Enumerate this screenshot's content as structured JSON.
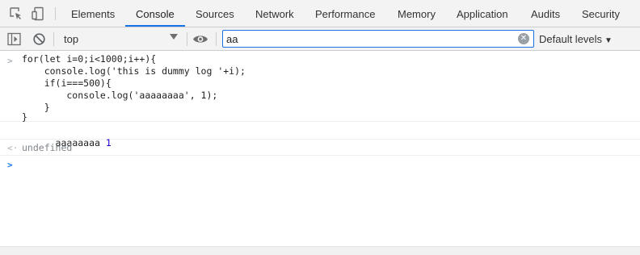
{
  "tabs": [
    {
      "label": "Elements"
    },
    {
      "label": "Console"
    },
    {
      "label": "Sources"
    },
    {
      "label": "Network"
    },
    {
      "label": "Performance"
    },
    {
      "label": "Memory"
    },
    {
      "label": "Application"
    },
    {
      "label": "Audits"
    },
    {
      "label": "Security"
    }
  ],
  "active_tab": "Console",
  "toolbar": {
    "context": "top",
    "filter_value": "aa",
    "levels_label": "Default levels"
  },
  "console": {
    "input_lines": [
      "for(let i=0;i<1000;i++){",
      "    console.log('this is dummy log '+i);",
      "    if(i===500){",
      "        console.log('aaaaaaaa', 1);",
      "    }",
      "}"
    ],
    "log_message": {
      "text": "aaaaaaaa",
      "value": "1"
    },
    "result": "undefined"
  },
  "colors": {
    "accent": "#1a73e8",
    "toolbar_bg": "#f3f3f3",
    "number": "#1c00cf"
  },
  "icons": {
    "inspect": "inspect-element-icon",
    "device": "device-toolbar-icon",
    "sidebar": "show-sidebar-icon",
    "clear": "clear-console-icon",
    "eye": "live-expression-icon"
  }
}
